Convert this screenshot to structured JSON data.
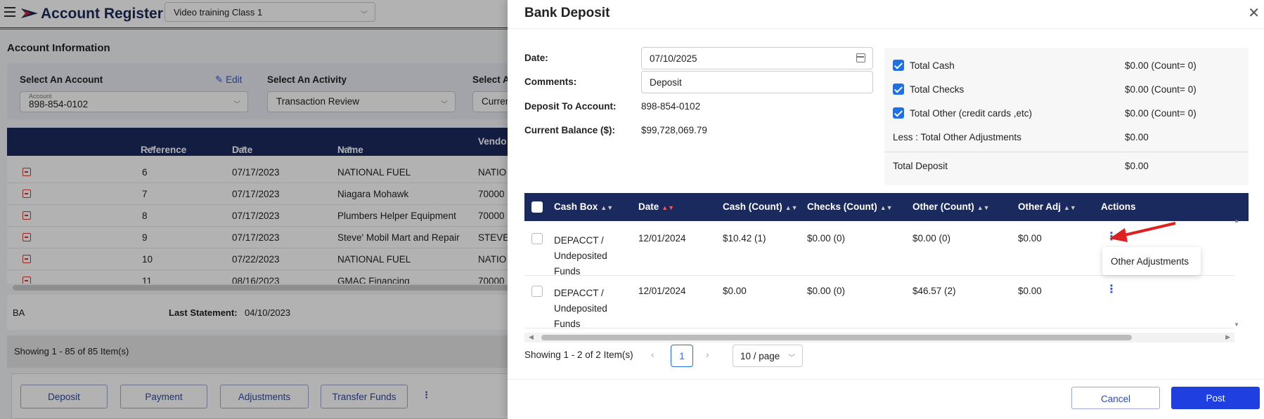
{
  "app": {
    "title": "Account Register",
    "class_select": "Video training Class 1"
  },
  "account_info": {
    "section_title": "Account Information",
    "select_account_label": "Select An Account",
    "edit_label": "Edit",
    "account_tiny_label": "Account",
    "account_value": "898-854-0102",
    "select_activity_label": "Select An Activity",
    "activity_value": "Transaction Review",
    "select_a_label": "Select A",
    "curr_value": "Curren"
  },
  "register": {
    "headers": [
      "Reference",
      "Date",
      "Name",
      "Vendo"
    ],
    "rows": [
      {
        "ref": "6",
        "date": "07/17/2023",
        "name": "NATIONAL FUEL",
        "vendor": "NATIO"
      },
      {
        "ref": "7",
        "date": "07/17/2023",
        "name": "Niagara Mohawk",
        "vendor": "70000"
      },
      {
        "ref": "8",
        "date": "07/17/2023",
        "name": "Plumbers Helper Equipment",
        "vendor": "70000"
      },
      {
        "ref": "9",
        "date": "07/17/2023",
        "name": "Steve' Mobil Mart and Repair",
        "vendor": "STEVE"
      },
      {
        "ref": "10",
        "date": "07/22/2023",
        "name": "NATIONAL FUEL",
        "vendor": "NATIO"
      },
      {
        "ref": "11",
        "date": "08/16/2023",
        "name": "GMAC Financing",
        "vendor": "70000"
      }
    ],
    "ba_label": "BA",
    "last_statement_label": "Last Statement:",
    "last_statement_value": "04/10/2023",
    "showing": "Showing 1 - 85 of 85 Item(s)"
  },
  "bottom_buttons": {
    "deposit": "Deposit",
    "payment": "Payment",
    "adjustments": "Adjustments",
    "transfer": "Transfer Funds"
  },
  "drawer": {
    "title": "Bank Deposit",
    "date_label": "Date:",
    "date_value": "07/10/2025",
    "comments_label": "Comments:",
    "comments_value": "Deposit",
    "deposit_to_label": "Deposit To Account:",
    "deposit_to_value": "898-854-0102",
    "current_balance_label": "Current Balance ($):",
    "current_balance_value": "$99,728,069.79",
    "totals": [
      {
        "label": "Total Cash",
        "value": "$0.00 (Count= 0)",
        "checked": true
      },
      {
        "label": "Total Checks",
        "value": "$0.00 (Count= 0)",
        "checked": true
      },
      {
        "label": "Total Other (credit cards ,etc)",
        "value": "$0.00 (Count= 0)",
        "checked": true
      },
      {
        "label": "Less : Total Other Adjustments",
        "value": "$0.00",
        "checked": false
      },
      {
        "label": "Total Deposit",
        "value": "$0.00",
        "checked": false
      }
    ],
    "grid": {
      "headers": [
        "Cash Box",
        "Date",
        "Cash (Count)",
        "Checks (Count)",
        "Other (Count)",
        "Other Adj",
        "Actions"
      ],
      "rows": [
        {
          "cash_box_1": "DEPACCT /",
          "cash_box_2": "Undeposited",
          "cash_box_3": "Funds",
          "date": "12/01/2024",
          "cash": "$10.42 (1)",
          "checks": "$0.00 (0)",
          "other": "$0.00 (0)",
          "other_adj": "$0.00"
        },
        {
          "cash_box_1": "DEPACCT /",
          "cash_box_2": "Undeposited",
          "cash_box_3": "Funds",
          "date": "12/01/2024",
          "cash": "$0.00",
          "checks": "$0.00 (0)",
          "other": "$46.57 (2)",
          "other_adj": "$0.00"
        }
      ]
    },
    "popup_item": "Other Adjustments",
    "showing": "Showing 1 - 2 of 2 Item(s)",
    "current_page": "1",
    "page_size": "10 / page",
    "cancel_label": "Cancel",
    "post_label": "Post"
  }
}
